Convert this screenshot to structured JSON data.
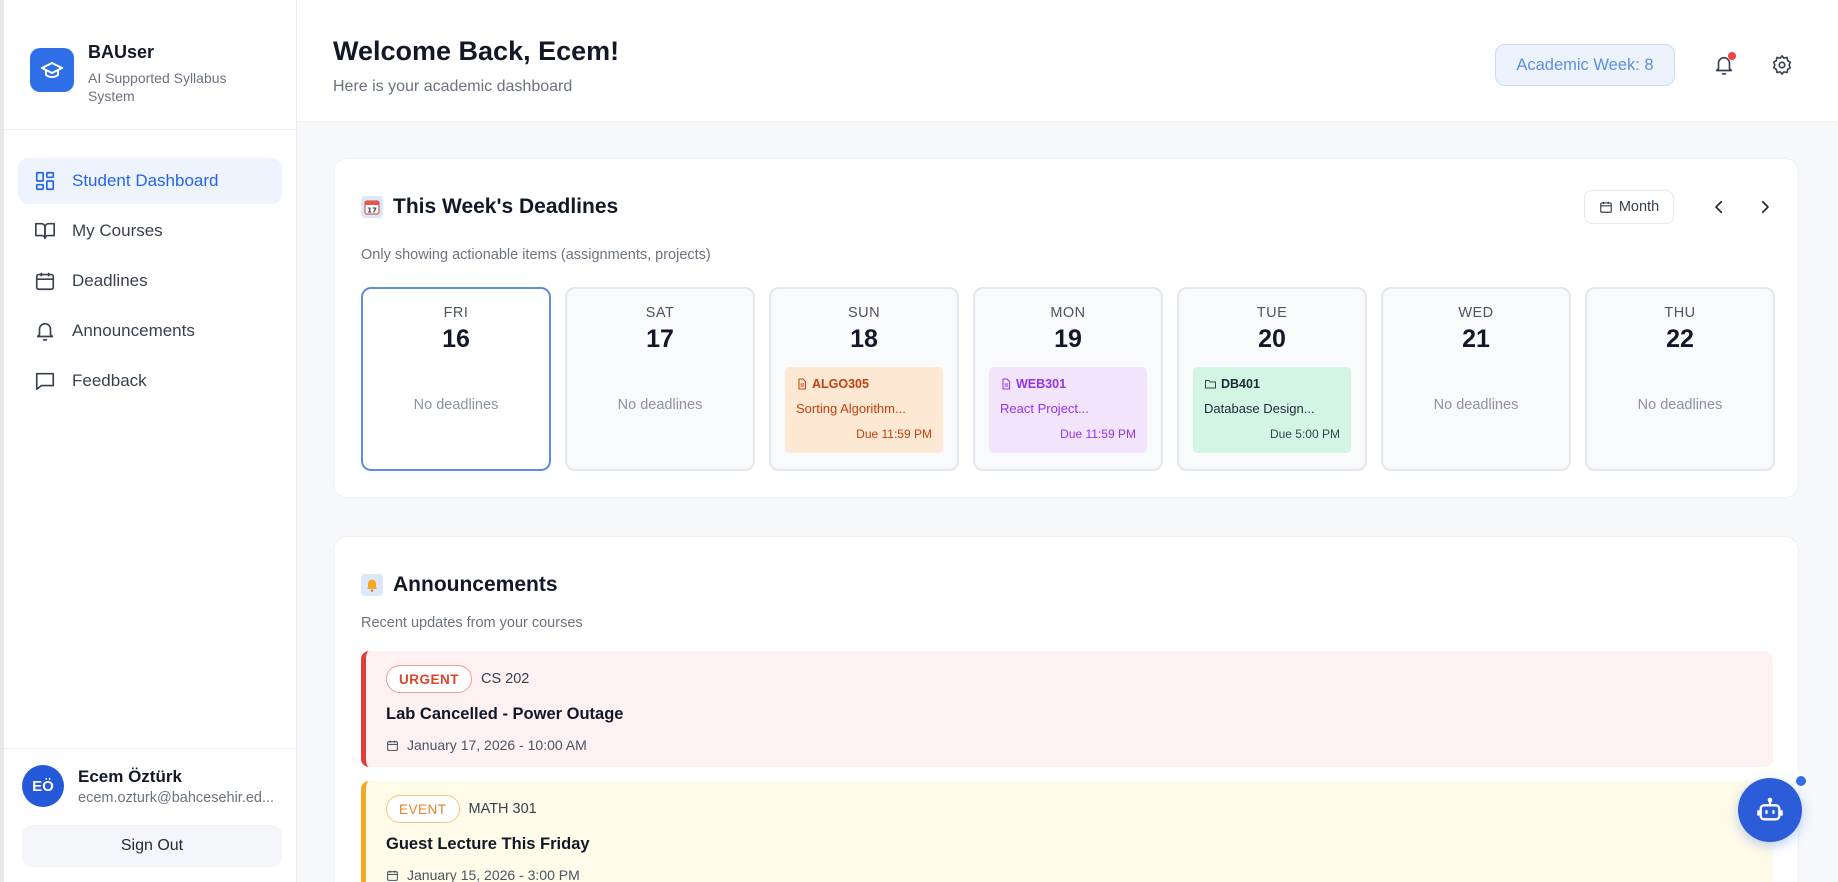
{
  "brand": {
    "name": "BAUser",
    "subtitle": "AI Supported Syllabus System"
  },
  "nav": {
    "items": [
      {
        "label": "Student Dashboard",
        "icon": "dashboard-icon",
        "active": true
      },
      {
        "label": "My Courses",
        "icon": "book-icon",
        "active": false
      },
      {
        "label": "Deadlines",
        "icon": "calendar-icon",
        "active": false
      },
      {
        "label": "Announcements",
        "icon": "bell-icon",
        "active": false
      },
      {
        "label": "Feedback",
        "icon": "message-icon",
        "active": false
      }
    ]
  },
  "user": {
    "initials": "EÖ",
    "name": "Ecem Öztürk",
    "email": "ecem.ozturk@bahcesehir.ed...",
    "signout_label": "Sign Out"
  },
  "header": {
    "title": "Welcome Back, Ecem!",
    "subtitle": "Here is your academic dashboard",
    "academic_week": "Academic Week: 8"
  },
  "deadlines": {
    "title": "This Week's Deadlines",
    "subtitle": "Only showing actionable items (assignments, projects)",
    "month_label": "Month",
    "empty_label": "No deadlines",
    "days": [
      {
        "name": "FRI",
        "num": "16"
      },
      {
        "name": "SAT",
        "num": "17"
      },
      {
        "name": "SUN",
        "num": "18",
        "item": {
          "code": "ALGO305",
          "title": "Sorting Algorithm...",
          "due": "Due 11:59 PM"
        }
      },
      {
        "name": "MON",
        "num": "19",
        "item": {
          "code": "WEB301",
          "title": "React Project...",
          "due": "Due 11:59 PM"
        }
      },
      {
        "name": "TUE",
        "num": "20",
        "item": {
          "code": "DB401",
          "title": "Database Design...",
          "due": "Due 5:00 PM"
        }
      },
      {
        "name": "WED",
        "num": "21"
      },
      {
        "name": "THU",
        "num": "22"
      }
    ]
  },
  "announcements": {
    "title": "Announcements",
    "subtitle": "Recent updates from your courses",
    "items": [
      {
        "tag": "URGENT",
        "course": "CS 202",
        "title": "Lab Cancelled - Power Outage",
        "date": "January 17, 2026 - 10:00 AM"
      },
      {
        "tag": "EVENT",
        "course": "MATH 301",
        "title": "Guest Lecture This Friday",
        "date": "January 15, 2026 - 3:00 PM"
      }
    ]
  },
  "colors": {
    "accent": "#2563eb",
    "urgent": "#e23d3d",
    "event": "#f5a623"
  }
}
